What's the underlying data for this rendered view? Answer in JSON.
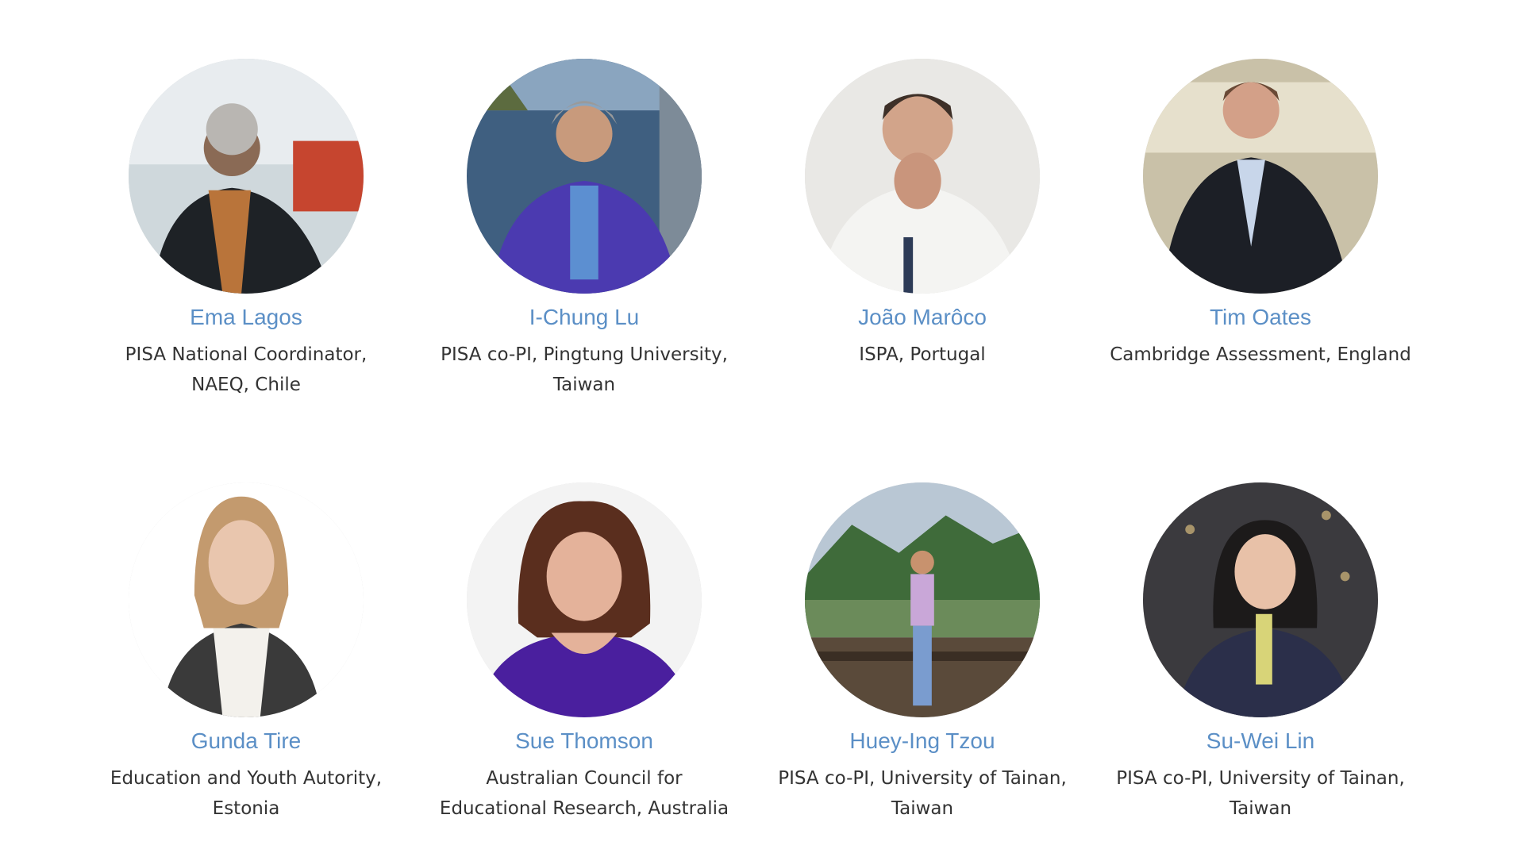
{
  "people": [
    {
      "name": "Ema Lagos",
      "role": "PISA National Coordinator, NAEQ, Chile"
    },
    {
      "name": "I-Chung Lu",
      "role": "PISA co-PI, Pingtung University, Taiwan"
    },
    {
      "name": "João Marôco",
      "role": "ISPA, Portugal"
    },
    {
      "name": "Tim Oates",
      "role": "Cambridge Assessment, England"
    },
    {
      "name": "Gunda Tire",
      "role": "Education and  Youth Autority, Estonia"
    },
    {
      "name": "Sue Thomson",
      "role": "Australian Council for Educational Research, Australia"
    },
    {
      "name": "Huey-Ing Tzou",
      "role": "PISA co-PI, University of Tainan, Taiwan"
    },
    {
      "name": "Su-Wei Lin",
      "role": "PISA co-PI, University of Tainan, Taiwan"
    }
  ],
  "colors": {
    "name": "#5b8fc6",
    "role": "#333333",
    "background": "#ffffff"
  }
}
